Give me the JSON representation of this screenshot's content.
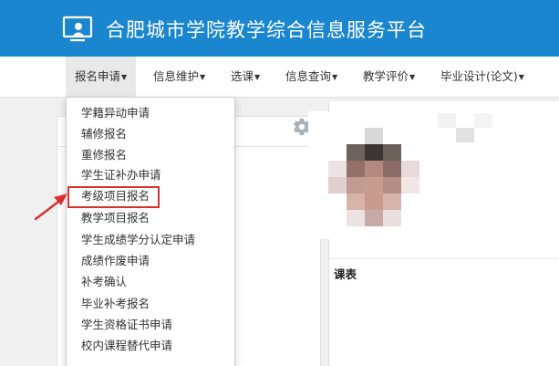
{
  "header": {
    "title": "合肥城市学院教学综合信息服务平台"
  },
  "nav": {
    "items": [
      {
        "label": "报名申请"
      },
      {
        "label": "信息维护"
      },
      {
        "label": "选课"
      },
      {
        "label": "信息查询"
      },
      {
        "label": "教学评价"
      },
      {
        "label": "毕业设计(论文)"
      }
    ]
  },
  "dropdown": {
    "items": [
      {
        "label": "学籍异动申请"
      },
      {
        "label": "辅修报名"
      },
      {
        "label": "重修报名"
      },
      {
        "label": "学生证补办申请"
      },
      {
        "label": "考级项目报名"
      },
      {
        "label": "教学项目报名"
      },
      {
        "label": "学生成绩学分认定申请"
      },
      {
        "label": "成绩作废申请"
      },
      {
        "label": "补考确认"
      },
      {
        "label": "毕业补考报名"
      },
      {
        "label": "学生资格证书申请"
      },
      {
        "label": "校内课程替代申请"
      }
    ]
  },
  "right_panel": {
    "schedule_title": "课表"
  },
  "colors": {
    "header_bg": "#1a86d0",
    "highlight": "#d9302c"
  }
}
